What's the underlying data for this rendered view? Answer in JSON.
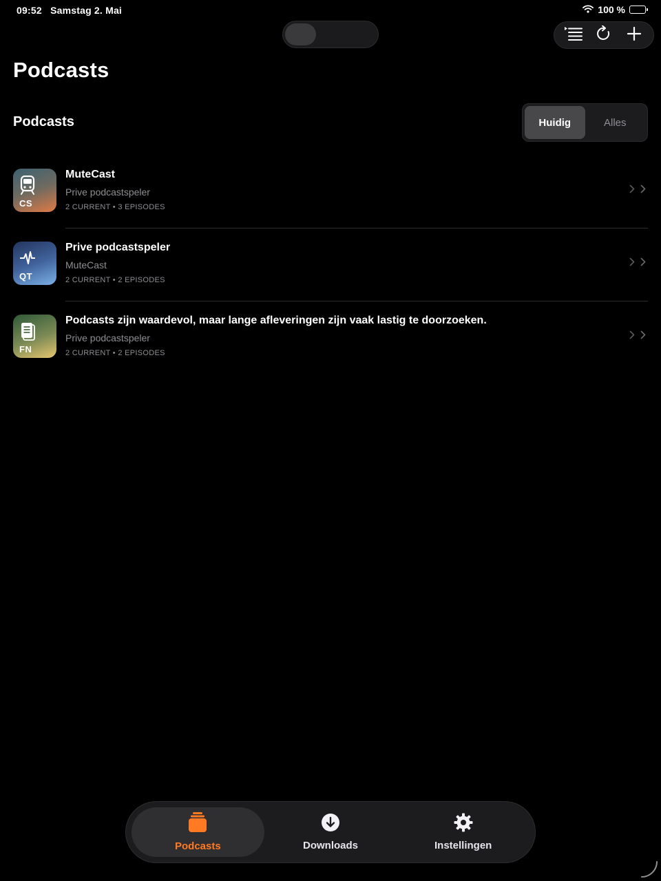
{
  "status_bar": {
    "time_date": "09:52   Samstag 2. Mai",
    "battery_text": "100 %"
  },
  "toolbar": {
    "icons": [
      "list-icon",
      "refresh-icon",
      "plus-icon"
    ]
  },
  "page": {
    "title": "Podcasts",
    "section_title": "Podcasts"
  },
  "segmented": {
    "options": [
      "Huidig",
      "Alles"
    ],
    "selected": "Huidig"
  },
  "podcasts": [
    {
      "initials": "CS",
      "icon": "tram-icon",
      "title": "MuteCast",
      "subtitle": "Prive podcastspeler",
      "meta": "2 CURRENT • 3 EPISODES",
      "gradient": [
        "#3d6272",
        "#e07a45"
      ]
    },
    {
      "initials": "QT",
      "icon": "waveform-icon",
      "title": "Prive podcastspeler",
      "subtitle": "MuteCast",
      "meta": "2 CURRENT • 2 EPISODES",
      "gradient": [
        "#2a3f6e",
        "#7ab0e6"
      ]
    },
    {
      "initials": "FN",
      "icon": "document-icon",
      "title": "Podcasts zijn waardevol, maar lange afleveringen zijn vaak lastig te doorzoeken.",
      "subtitle": "Prive podcastspeler",
      "meta": "2 CURRENT • 2 EPISODES",
      "gradient": [
        "#2f5a38",
        "#e6c66e"
      ]
    }
  ],
  "tabbar": {
    "tabs": [
      {
        "label": "Podcasts",
        "icon": "podcasts-stack-icon",
        "active": true
      },
      {
        "label": "Downloads",
        "icon": "download-icon",
        "active": false
      },
      {
        "label": "Instellingen",
        "icon": "gear-icon",
        "active": false
      }
    ]
  },
  "colors": {
    "accent": "#ff7a22",
    "background": "#000000",
    "secondary_text": "#8e8e93"
  }
}
